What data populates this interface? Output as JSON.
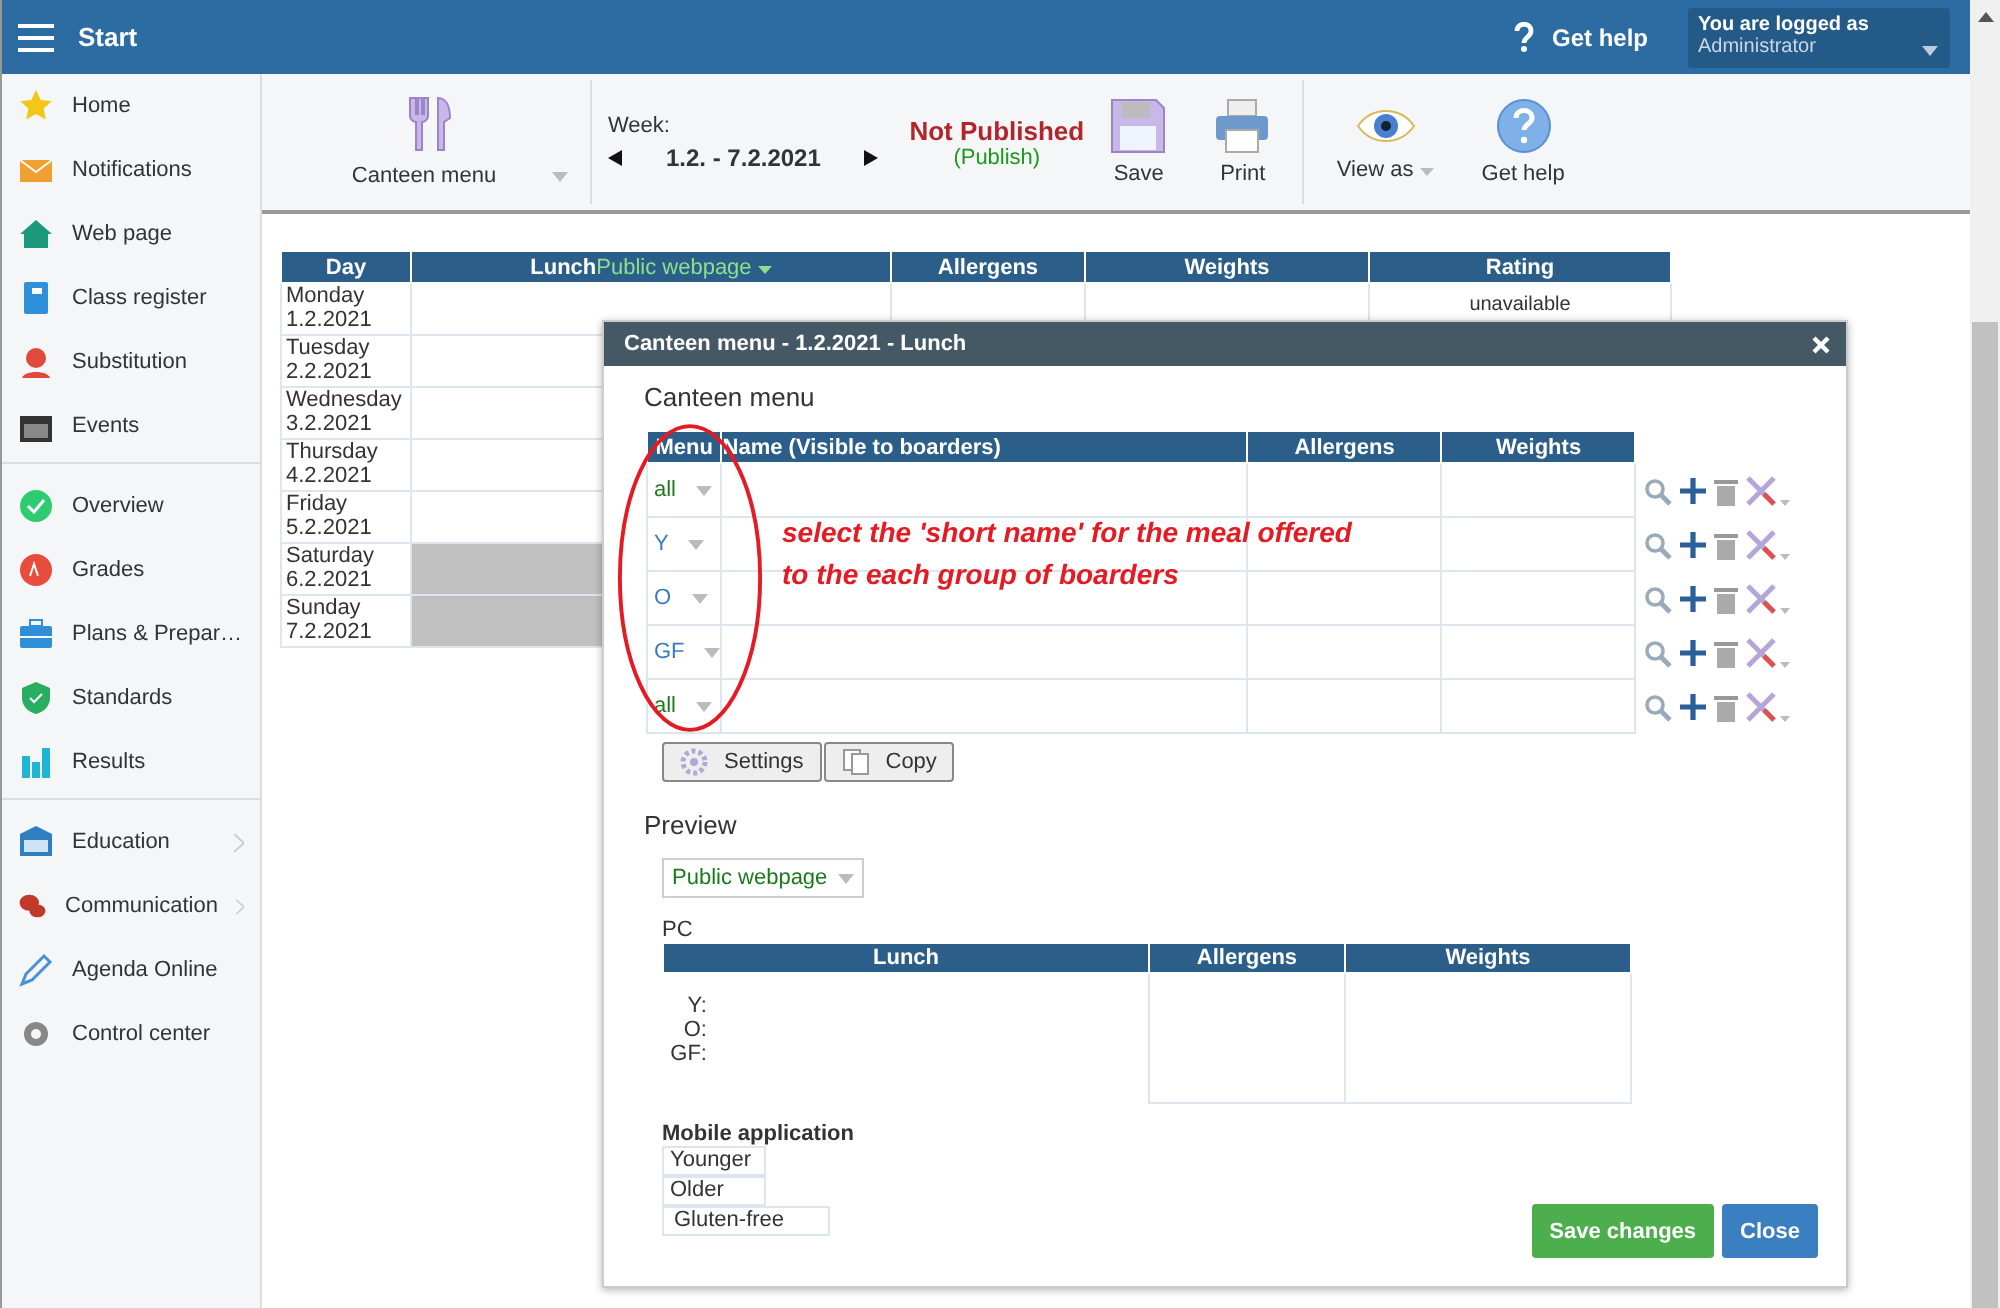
{
  "top_bar": {
    "menu_label": "Start",
    "help": "Get help",
    "user": {
      "caption": "You are logged as",
      "name": "Administrator"
    }
  },
  "sidebar": {
    "groups": [
      {
        "items": [
          {
            "label": "Home",
            "submenu": false
          },
          {
            "label": "Notifications",
            "submenu": false
          },
          {
            "label": "Web page",
            "submenu": false
          },
          {
            "label": "Class register",
            "submenu": false
          },
          {
            "label": "Substitution",
            "submenu": false
          },
          {
            "label": "Events",
            "submenu": false
          }
        ]
      },
      {
        "items": [
          {
            "label": "Overview",
            "submenu": false
          },
          {
            "label": "Grades",
            "submenu": false
          },
          {
            "label": "Plans & Prepar…",
            "submenu": false
          },
          {
            "label": "Standards",
            "submenu": false
          },
          {
            "label": "Results",
            "submenu": false
          }
        ]
      },
      {
        "items": [
          {
            "label": "Education",
            "submenu": true
          },
          {
            "label": "Communication",
            "submenu": true
          },
          {
            "label": "Agenda Online",
            "submenu": false
          },
          {
            "label": "Control center",
            "submenu": false
          }
        ]
      }
    ]
  },
  "toolbar": {
    "module": "Canteen menu",
    "week_label": "Week:",
    "week_range": "1.2. - 7.2.2021",
    "status": "Not Published",
    "publish": "(Publish)",
    "save": "Save",
    "print": "Print",
    "view_as": "View as",
    "help": "Get help"
  },
  "week_table": {
    "columns": [
      "Day",
      "Lunch",
      "Allergens",
      "Weights",
      "Rating"
    ],
    "lunch_filter": "Public webpage",
    "rows": [
      {
        "day": "Monday",
        "date": "1.2.2021",
        "weekend": false,
        "rating": "unavailable"
      },
      {
        "day": "Tuesday",
        "date": "2.2.2021",
        "weekend": false
      },
      {
        "day": "Wednesday",
        "date": "3.2.2021",
        "weekend": false
      },
      {
        "day": "Thursday",
        "date": "4.2.2021",
        "weekend": false
      },
      {
        "day": "Friday",
        "date": "5.2.2021",
        "weekend": false
      },
      {
        "day": "Saturday",
        "date": "6.2.2021",
        "weekend": true
      },
      {
        "day": "Sunday",
        "date": "7.2.2021",
        "weekend": true
      }
    ]
  },
  "dialog": {
    "title": "Canteen menu - 1.2.2021 - Lunch",
    "section": "Canteen menu",
    "columns": [
      "Menu",
      "Name (Visible to boarders)",
      "Allergens",
      "Weights"
    ],
    "rows": [
      {
        "menu": "all",
        "color": "#1e7a1e"
      },
      {
        "menu": "Y",
        "color": "#3a7cc0"
      },
      {
        "menu": "O",
        "color": "#3a7cc0"
      },
      {
        "menu": "GF",
        "color": "#3a7cc0"
      },
      {
        "menu": "all",
        "color": "#1e7a1e"
      }
    ],
    "annotation": "select the 'short name' for the meal offered to the each group of boarders",
    "settings": "Settings",
    "copy": "Copy",
    "preview": {
      "title": "Preview",
      "view": "Public webpage",
      "pc_label": "PC",
      "columns": [
        "Lunch",
        "Allergens",
        "Weights"
      ],
      "lines": [
        "Y:",
        "O:",
        "GF:"
      ],
      "mobile_label": "Mobile application",
      "mobile_items": [
        "Younger",
        "Older",
        "Gluten-free"
      ]
    },
    "save": "Save changes",
    "close": "Close"
  }
}
